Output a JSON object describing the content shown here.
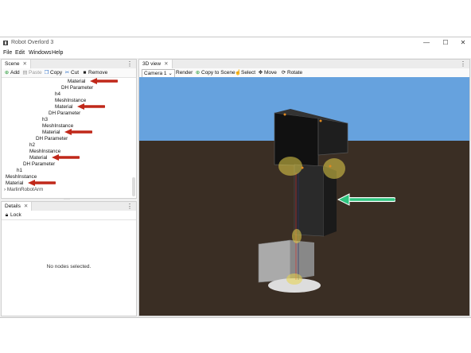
{
  "window": {
    "title": "Robot Overlord 3",
    "controls": [
      "—",
      "☐",
      "✕"
    ]
  },
  "menu": [
    "File",
    "Edit",
    "Windows",
    "Help"
  ],
  "scene_panel": {
    "tab": "Scene",
    "close": "✕",
    "toolbar": {
      "add": "Add",
      "paste": "Paste",
      "copy": "Copy",
      "cut": "Cut",
      "remove": "Remove"
    },
    "tree": [
      {
        "label": "Material",
        "arrow": true
      },
      {
        "label": "DH Parameter",
        "arrow": false
      },
      {
        "label": "h4",
        "arrow": false
      },
      {
        "label": "MeshInstance",
        "arrow": false
      },
      {
        "label": "Material",
        "arrow": true
      },
      {
        "label": "DH Parameter",
        "arrow": false
      },
      {
        "label": "h3",
        "arrow": false
      },
      {
        "label": "MeshInstance",
        "arrow": false
      },
      {
        "label": "Material",
        "arrow": true
      },
      {
        "label": "DH Parameter",
        "arrow": false
      },
      {
        "label": "h2",
        "arrow": false
      },
      {
        "label": "MeshInstance",
        "arrow": false
      },
      {
        "label": "Material",
        "arrow": true
      },
      {
        "label": "DH Parameter",
        "arrow": false
      },
      {
        "label": "h1",
        "arrow": false
      },
      {
        "label": "MeshInstance",
        "arrow": false
      },
      {
        "label": "Material",
        "arrow": true
      },
      {
        "label": "MarlinRobotArm",
        "arrow": false
      }
    ]
  },
  "details_panel": {
    "tab": "Details",
    "close": "✕",
    "lock": "Lock",
    "empty_message": "No nodes selected."
  },
  "view_panel": {
    "tab": "3D view",
    "close": "✕",
    "toolbar": {
      "camera": "Camera 1",
      "render": "Render",
      "copy_to_scene": "Copy to Scene",
      "select": "Select",
      "move": "Move",
      "rotate": "Rotate"
    }
  },
  "colors": {
    "annotation_red": "#c0281a",
    "annotation_green": "#2ec47f",
    "sky": "#66a2de",
    "ground": "#3a2e24"
  }
}
